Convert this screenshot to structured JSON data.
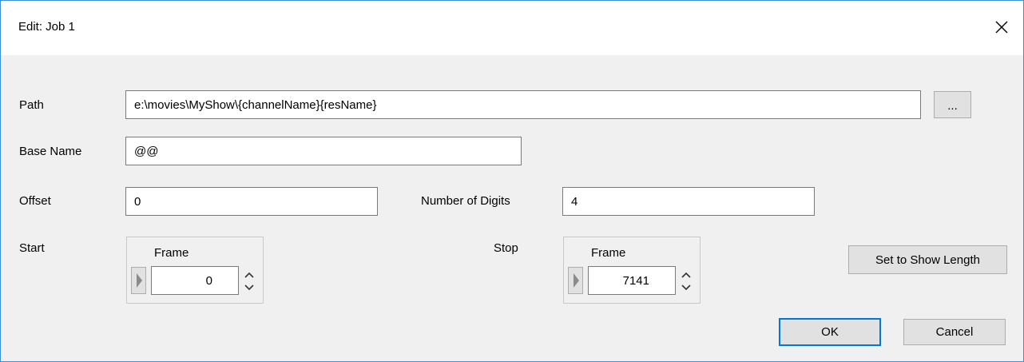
{
  "window": {
    "title": "Edit: Job 1"
  },
  "form": {
    "path": {
      "label": "Path",
      "value": "e:\\movies\\MyShow\\{channelName}{resName}",
      "browse_label": "..."
    },
    "base_name": {
      "label": "Base Name",
      "value": "@@"
    },
    "offset": {
      "label": "Offset",
      "value": "0"
    },
    "digits": {
      "label": "Number of Digits",
      "value": "4"
    },
    "start": {
      "label": "Start",
      "unit": "Frame",
      "value": "0"
    },
    "stop": {
      "label": "Stop",
      "unit": "Frame",
      "value": "7141"
    },
    "set_length_label": "Set to Show Length"
  },
  "buttons": {
    "ok": "OK",
    "cancel": "Cancel"
  },
  "colors": {
    "accent": "#0078d7",
    "window_border": "#3c8fd6",
    "background": "#f0f0f0"
  },
  "icons": {
    "close": "close-icon",
    "arrow": "play-arrow-icon",
    "spinner": "spin-up-down-icon"
  }
}
